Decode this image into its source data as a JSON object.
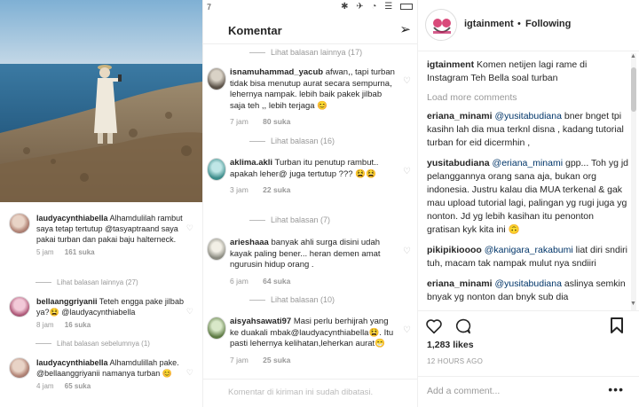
{
  "left_panel": {
    "comments": [
      {
        "user": "laudyacynthiabella",
        "text": "Alhamdulilah rambut saya tetap tertutup @tasyaptraand saya pakai turban dan pakai baju halterneck.",
        "time": "5 jam",
        "likes": "161 suka"
      },
      {
        "user": "bellaanggriyanii",
        "text": "Teteh engga pake jilbab ya?😫 @laudyacynthiabella",
        "time": "8 jam",
        "likes": "16 suka"
      },
      {
        "user": "laudyacynthiabella",
        "text": "Alhamdulillah pake. @bellaanggriyanii namanya turban 😊",
        "time": "4 jam",
        "likes": "65 suka"
      }
    ],
    "replies_more": "Lihat balasan lainnya (27)",
    "replies_prev": "Lihat balasan sebelumnya (1)"
  },
  "mobile": {
    "status_time": "7",
    "header_title": "Komentar",
    "replies": [
      "Lihat balasan lainnya (17)",
      "Lihat balasan (16)",
      "Lihat balasan (7)",
      "Lihat balasan (10)"
    ],
    "comments": [
      {
        "user": "isnamuhammad_yacub",
        "text": "afwan,, tapi turban tidak bisa menutup aurat secara sempurna, lehernya nampak. lebih baik pakek jilbab saja teh ,, lebih terjaga 😊",
        "time": "7 jam",
        "likes": "80 suka"
      },
      {
        "user": "aklima.akli",
        "text": "Turban itu penutup rambut.. apakah leher@ juga tertutup ??? 😫😫",
        "time": "3 jam",
        "likes": "22 suka"
      },
      {
        "user": "arieshaaa",
        "text": "banyak ahli surga disini udah kayak paling bener... heran demen amat ngurusin hidup orang .",
        "time": "6 jam",
        "likes": "64 suka"
      },
      {
        "user": "aisyahsawati97",
        "text": "Masi perlu berhijrah yang ke duakali mbak@laudyacynthiabella😫. Itu pasti lehernya kelihatan,leherkan aurat😁",
        "time": "7 jam",
        "likes": "25 suka"
      }
    ],
    "input_placeholder": "Komentar di kiriman ini sudah dibatasi."
  },
  "post": {
    "username": "igtainment",
    "separator": "•",
    "follow_status": "Following",
    "caption": {
      "user": "igtainment",
      "text": "Komen netijen lagi rame di Instagram Teh Bella soal turban"
    },
    "load_more": "Load more comments",
    "comments": [
      {
        "user": "eriana_minami",
        "mention": "@yusitabudiana",
        "text": "bner bnget tpi kasihn lah dia mua terknl disna , kadang tutorial turban for eid dicermhin ,"
      },
      {
        "user": "yusitabudiana",
        "mention": "@eriana_minami",
        "text": "gpp... Toh yg jd pelanggannya orang sana aja, bukan org indonesia. Justru kalau dia MUA terkenal & gak mau upload tutorial lagi, palingan yg rugi juga yg nonton. Jd yg lebih kasihan itu penonton gratisan kyk kita ini 🙃"
      },
      {
        "user": "pikipikioooo",
        "mention": "@kanigara_rakabumi",
        "text": "liat diri sndiri tuh, macam tak nampak mulut nya sndiiri"
      },
      {
        "user": "eriana_minami",
        "mention": "@yusitabudiana",
        "text": "aslinya semkin bnyak yg nonton dan bnyk sub dia"
      }
    ],
    "likes": "1,283 likes",
    "time": "12 HOURS AGO",
    "add_comment_placeholder": "Add a comment...",
    "more_label": "•••"
  },
  "icons": {
    "heart": "heart-icon",
    "comment": "comment-icon",
    "bookmark": "bookmark-icon",
    "send": "send-icon"
  },
  "colors": {
    "mention": "#003569",
    "muted": "#999999",
    "sea": "#2e6f9a",
    "sky": "#a9c6dd",
    "land": "#8a6f55"
  }
}
